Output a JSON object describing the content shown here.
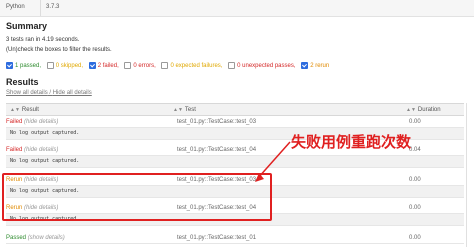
{
  "environment": {
    "key": "Python",
    "value": "3.7.3"
  },
  "summary": {
    "title": "Summary",
    "line1": "3 tests ran in 4.19 seconds.",
    "line2": "(Un)check the boxes to filter the results."
  },
  "filters": [
    {
      "label": "1 passed,",
      "checked": true,
      "cls": "passed"
    },
    {
      "label": "0 skipped,",
      "checked": false,
      "cls": "skipped"
    },
    {
      "label": "2 failed,",
      "checked": true,
      "cls": "failed"
    },
    {
      "label": "0 errors,",
      "checked": false,
      "cls": "errors"
    },
    {
      "label": "0 expected failures,",
      "checked": false,
      "cls": "xfail"
    },
    {
      "label": "0 unexpected passes,",
      "checked": false,
      "cls": "xpass"
    },
    {
      "label": "2 rerun",
      "checked": true,
      "cls": "rerun"
    }
  ],
  "results": {
    "title": "Results",
    "show_all": "Show all details",
    "sep": " / ",
    "hide_all": "Hide all details",
    "headers": {
      "result": "Result",
      "test": "Test",
      "duration": "Duration"
    },
    "rows": [
      {
        "status": "Failed",
        "toggle": "(hide details)",
        "test": "test_01.py::TestCase::test_03",
        "duration": "0.00",
        "log": "No log output captured.",
        "cls": "failed"
      },
      {
        "status": "Failed",
        "toggle": "(hide details)",
        "test": "test_01.py::TestCase::test_04",
        "duration": "0.04",
        "log": "No log output captured.",
        "cls": "failed"
      },
      {
        "status": "Rerun",
        "toggle": "(hide details)",
        "test": "test_01.py::TestCase::test_03",
        "duration": "0.00",
        "log": "No log output captured.",
        "cls": "rerun"
      },
      {
        "status": "Rerun",
        "toggle": "(hide details)",
        "test": "test_01.py::TestCase::test_04",
        "duration": "0.00",
        "log": "No log output captured.",
        "cls": "rerun"
      },
      {
        "status": "Passed",
        "toggle": "(show details)",
        "test": "test_01.py::TestCase::test_01",
        "duration": "0.00",
        "log": null,
        "cls": "passed"
      }
    ]
  },
  "annotation": "失败用例重跑次数",
  "colors": {
    "annotation": "#e02020",
    "failed": "#d42828",
    "passed": "#2e8b2e",
    "rerun": "#e08a00"
  }
}
